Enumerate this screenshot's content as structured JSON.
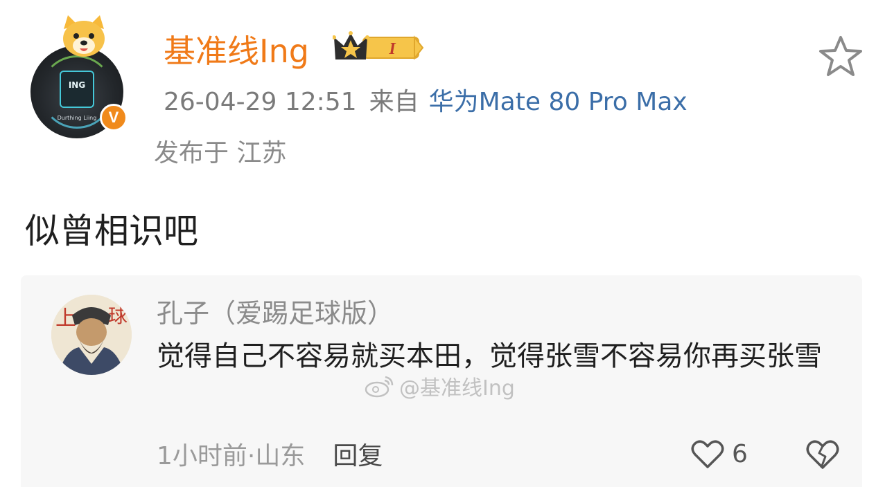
{
  "post": {
    "username": "基准线Ing",
    "timestamp": "26-04-29 12:51",
    "from_label": "来自",
    "device": "华为Mate 80 Pro Max",
    "location": "发布于 江苏",
    "text": "似曾相识吧",
    "avatar_text": "ING",
    "avatar_subtext": "Durthing Liing",
    "verified_badge": "V",
    "level_badge": "I",
    "icons": [
      "dog-avatar-icon",
      "crown-icon",
      "star-icon"
    ],
    "colors": {
      "username": "#f07a18",
      "device": "#3b6ea8",
      "verified": "#f08a1c"
    }
  },
  "comment": {
    "author": "孔子（爱踢足球版）",
    "text": "觉得自己不容易就买本田，觉得张雪不容易你再买张雪",
    "time": "1小时前·山东",
    "reply_label": "回复",
    "like_count": "6",
    "icons": [
      "heart-icon",
      "broken-heart-icon"
    ]
  },
  "watermark": {
    "text": "@基准线Ing"
  }
}
